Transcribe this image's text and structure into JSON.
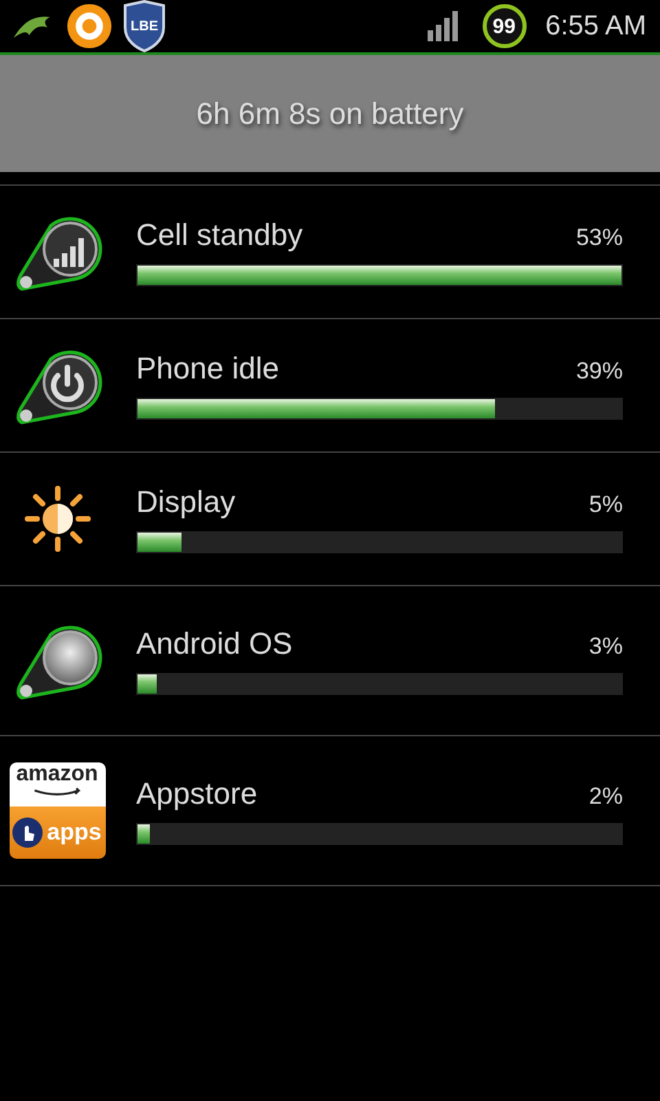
{
  "status_bar": {
    "badge": "LBE",
    "battery": "99",
    "time": "6:55 AM"
  },
  "header": {
    "title": "6h 6m 8s on battery"
  },
  "items": [
    {
      "kind": "signal",
      "name": "Cell standby",
      "percent": "53%",
      "level": 1.0
    },
    {
      "kind": "power",
      "name": "Phone idle",
      "percent": "39%",
      "level": 0.74
    },
    {
      "kind": "sun",
      "name": "Display",
      "percent": "5%",
      "level": 0.09
    },
    {
      "kind": "disc",
      "name": "Android OS",
      "percent": "3%",
      "level": 0.04
    },
    {
      "kind": "amazon",
      "name": "Appstore",
      "percent": "2%",
      "level": 0.025,
      "logo_top": "amazon",
      "logo_bottom": "apps"
    }
  ]
}
